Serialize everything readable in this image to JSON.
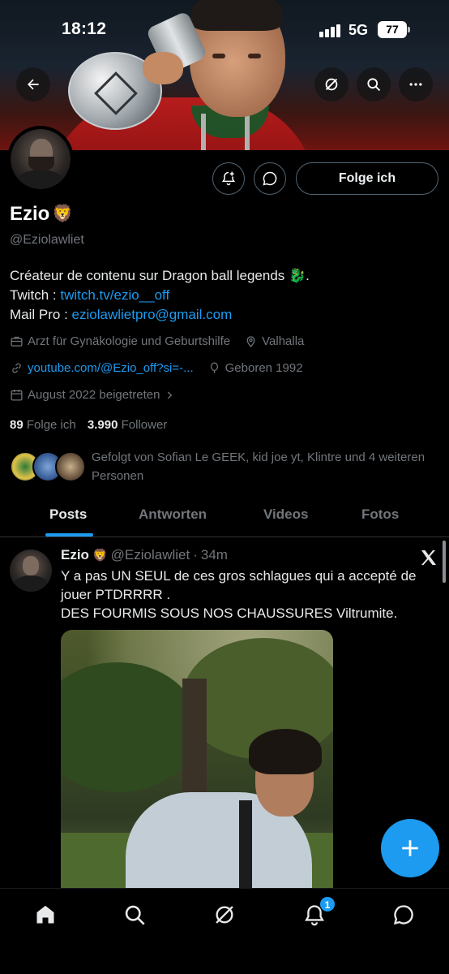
{
  "status_bar": {
    "time": "18:12",
    "network": "5G",
    "battery": "77"
  },
  "profile": {
    "display_name": "Ezio",
    "name_emoji": "🦁",
    "handle": "@Eziolawliet",
    "follow_button": "Folge ich",
    "bio": {
      "line1": "Créateur de contenu sur Dragon ball legends 🐉.",
      "twitch_label": "Twitch : ",
      "twitch_link": "twitch.tv/ezio__off",
      "mail_label": "Mail Pro : ",
      "mail_link": "eziolawlietpro@gmail.com"
    },
    "category": "Arzt für Gynäkologie und Geburtshilfe",
    "location": "Valhalla",
    "website": "youtube.com/@Ezio_off?si=-...",
    "birthday": "Geboren 1992",
    "joined": "August 2022 beigetreten",
    "following_count": "89",
    "following_label": "Folge ich",
    "followers_count": "3.990",
    "followers_label": "Follower",
    "followed_by": "Gefolgt von Sofian Le GEEK, kid joe yt, Klintre und 4 weiteren Personen"
  },
  "tabs": [
    "Posts",
    "Antworten",
    "Videos",
    "Fotos"
  ],
  "active_tab": "Posts",
  "post": {
    "author": "Ezio",
    "author_emoji": "🦁",
    "handle": "@Eziolawliet",
    "separator": "·",
    "time": "34m",
    "text_line1": "Y a pas UN SEUL de ces gros schlagues qui a accepté de jouer PTDRRRR .",
    "text_line2": "DES FOURMIS SOUS NOS CHAUSSURES Viltrumite."
  },
  "bottom_nav": [
    "home-icon",
    "search-icon",
    "grok-icon",
    "notifications-icon",
    "messages-icon"
  ],
  "notification_badge": "1",
  "colors": {
    "accent": "#1d9bf0",
    "background": "#000000",
    "secondary_text": "#71767b"
  }
}
